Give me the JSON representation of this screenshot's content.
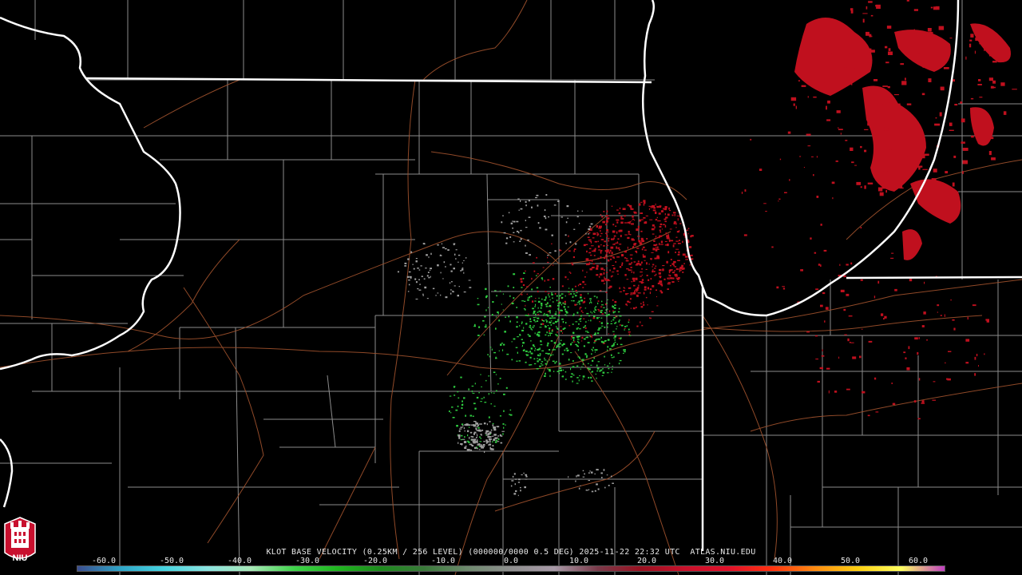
{
  "caption": "KLOT BASE VELOCITY (0.25KM / 256 LEVEL) (000000/0000 0.5 DEG) 2025-11-22 22:32 UTC  ATLAS.NIU.EDU",
  "logo_text": "NIU",
  "colorbar": {
    "ticks": [
      "-60.0",
      "-50.0",
      "-40.0",
      "-30.0",
      "-20.0",
      "-10.0",
      "0.0",
      "10.0",
      "20.0",
      "30.0",
      "40.0",
      "50.0",
      "60.0"
    ],
    "tick_values": [
      -60,
      -50,
      -40,
      -30,
      -20,
      -10,
      0,
      10,
      20,
      30,
      40,
      50,
      60
    ],
    "min": -64,
    "max": 64,
    "colors": [
      "#3b4d8f",
      "#2fa6c8",
      "#46d4e0",
      "#8be4e0",
      "#a8e8b8",
      "#3fd34a",
      "#1fb51f",
      "#1d8a1d",
      "#3a7a3a",
      "#6e8a6e",
      "#8f8f8f",
      "#a89aa8",
      "#7a3a4a",
      "#9a1020",
      "#c8102a",
      "#e0102a",
      "#ff3010",
      "#ff8a10",
      "#ffd010",
      "#ffff60",
      "#c040c0"
    ]
  },
  "colors": {
    "background": "#000000",
    "state_border": "#ffffff",
    "county_border": "#8c8c8c",
    "highway": "#a0522d",
    "inbound_velocity": "#2ecc40",
    "outbound_velocity": "#c0101e",
    "near_zero_velocity": "#a0a0a0"
  }
}
